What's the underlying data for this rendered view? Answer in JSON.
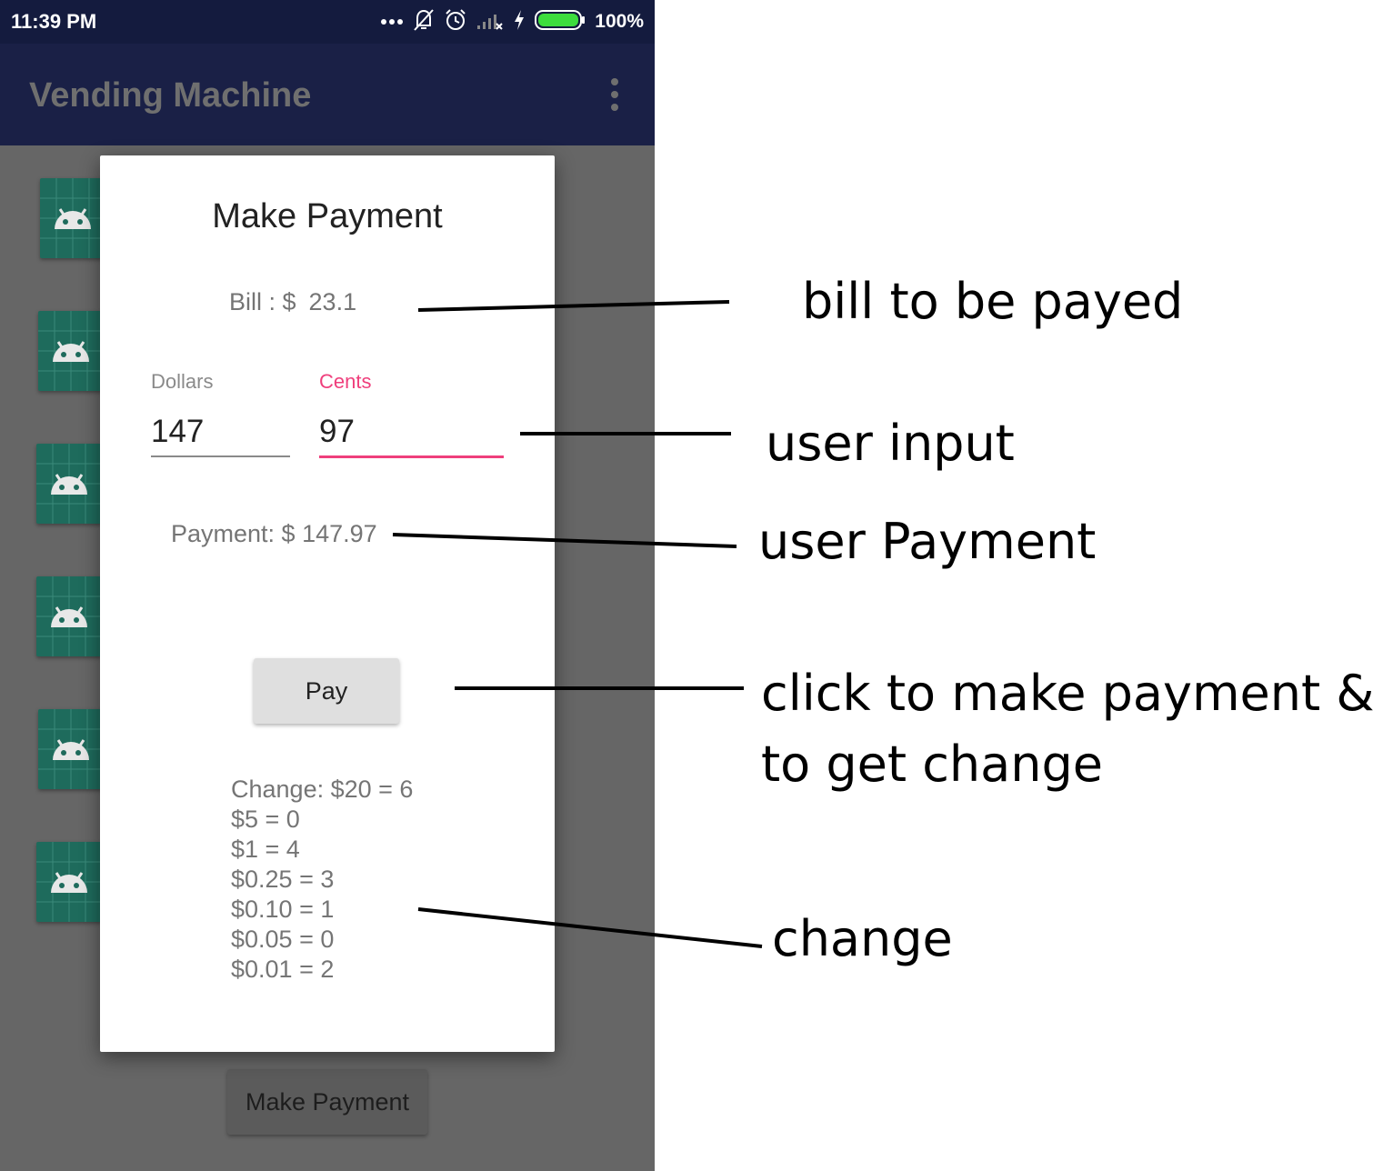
{
  "status_bar": {
    "time": "11:39 PM",
    "battery": "100%",
    "icons": [
      "more-dots-icon",
      "notifications-off-icon",
      "alarm-icon",
      "signal-icon",
      "charging-icon",
      "battery-icon"
    ]
  },
  "app_bar": {
    "title": "Vending Machine",
    "menu_icon": "overflow-menu-icon"
  },
  "list": {
    "item_icon": "android-icon"
  },
  "dialog": {
    "title": "Make Payment",
    "bill_label": "Bill : $",
    "bill_value": "23.1",
    "dollars_label": "Dollars",
    "dollars_value": "147",
    "cents_label": "Cents",
    "cents_value": "97",
    "payment_text": "Payment: $ 147.97",
    "pay_button": "Pay",
    "change_lines": [
      "Change: $20 = 6",
      "$5 = 0",
      "$1 = 4",
      "$0.25 = 3",
      "$0.10 = 1",
      "$0.05 = 0",
      "$0.01 = 2"
    ]
  },
  "bottom_button": "Make Payment",
  "annotations": {
    "bill": "bill to be payed",
    "input": "user input",
    "payment": "user Payment",
    "pay_line1": "click to make payment &",
    "pay_line2": "to get change",
    "change": "change"
  },
  "colors": {
    "status_bar": "#141b3e",
    "app_bar": "#1a2046",
    "accent": "#ef3f7c",
    "tile": "#1e6b5c"
  }
}
